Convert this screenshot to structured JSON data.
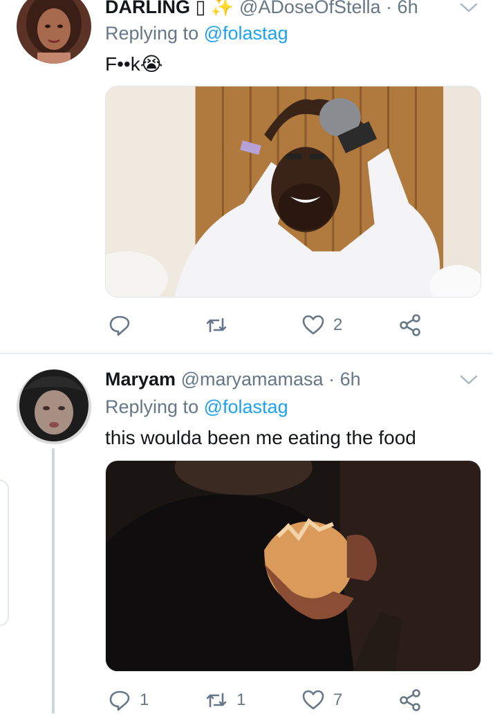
{
  "tweets": [
    {
      "name": "DARLING ▯",
      "name_emoji": "✨",
      "handle": "@ADoseOfStella",
      "separator": "·",
      "time": "6h",
      "replying_prefix": "Replying to",
      "replying_to": "@folastag",
      "text": "F••k😭",
      "actions": {
        "reply_count": "",
        "retweet_count": "",
        "like_count": "2"
      }
    },
    {
      "name": "Maryam",
      "handle": "@maryamamasa",
      "separator": "·",
      "time": "6h",
      "replying_prefix": "Replying to",
      "replying_to": "@folastag",
      "text": "this woulda been me eating the food",
      "actions": {
        "reply_count": "1",
        "retweet_count": "1",
        "like_count": "7"
      }
    }
  ],
  "icons": {
    "reply": "reply-icon",
    "retweet": "retweet-icon",
    "like": "heart-icon",
    "share": "share-icon",
    "more": "chevron-down-icon"
  },
  "colors": {
    "link": "#1da1f2",
    "secondary_text": "#657786",
    "primary_text": "#14171a",
    "divider": "#e6ecf0"
  }
}
